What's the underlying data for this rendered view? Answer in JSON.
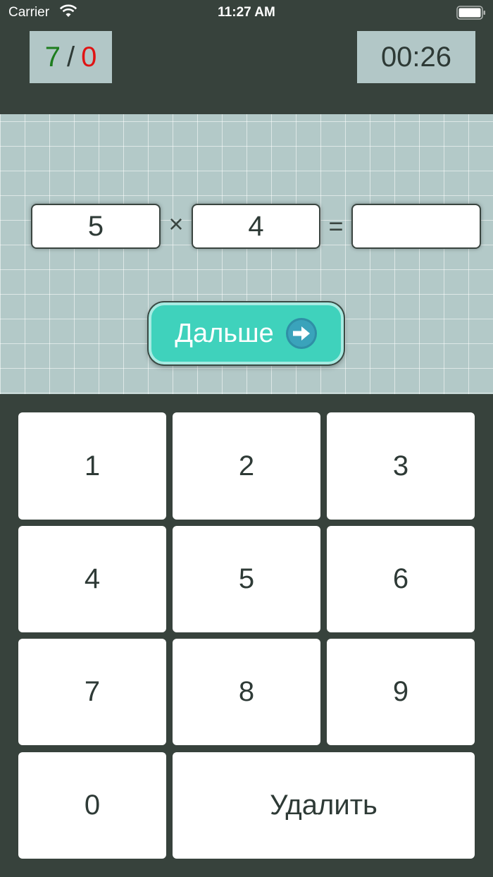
{
  "status_bar": {
    "carrier": "Carrier",
    "time": "11:27 AM"
  },
  "score": {
    "correct": "7",
    "separator": "/",
    "wrong": "0"
  },
  "timer": "00:26",
  "problem": {
    "operand_a": "5",
    "operator": "×",
    "operand_b": "4",
    "equals": "=",
    "answer": ""
  },
  "next_button": {
    "label": "Дальше",
    "icon": "arrow-right-icon"
  },
  "keypad": {
    "k1": "1",
    "k2": "2",
    "k3": "3",
    "k4": "4",
    "k5": "5",
    "k6": "6",
    "k7": "7",
    "k8": "8",
    "k9": "9",
    "k0": "0",
    "delete": "Удалить"
  },
  "colors": {
    "background": "#37423c",
    "panel": "#b2c7c7",
    "grid": "#b3c9c8",
    "accent": "#3fd2bc",
    "correct": "#1e7d1e",
    "wrong": "#e01414"
  }
}
